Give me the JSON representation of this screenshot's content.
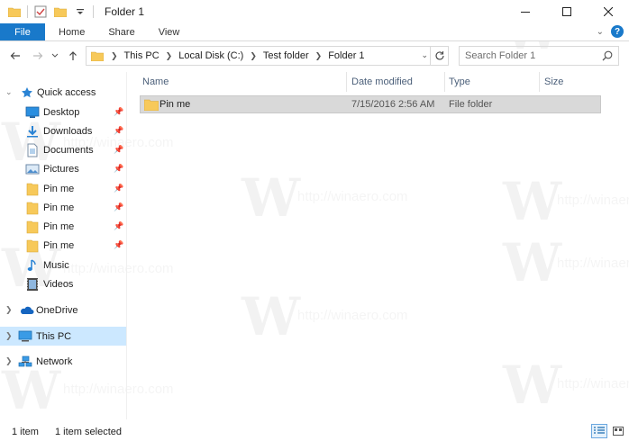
{
  "window": {
    "title": "Folder 1"
  },
  "ribbon": {
    "tabs": [
      {
        "label": "File"
      },
      {
        "label": "Home"
      },
      {
        "label": "Share"
      },
      {
        "label": "View"
      }
    ],
    "help_label": "?"
  },
  "address": {
    "crumbs": [
      "This PC",
      "Local Disk (C:)",
      "Test folder",
      "Folder 1"
    ]
  },
  "search": {
    "placeholder": "Search Folder 1"
  },
  "nav": {
    "quick_access": "Quick access",
    "items": [
      {
        "label": "Desktop",
        "icon": "desktop-icon",
        "pinned": true
      },
      {
        "label": "Downloads",
        "icon": "downloads-icon",
        "pinned": true
      },
      {
        "label": "Documents",
        "icon": "documents-icon",
        "pinned": true
      },
      {
        "label": "Pictures",
        "icon": "pictures-icon",
        "pinned": true
      },
      {
        "label": "Pin me",
        "icon": "folder-icon",
        "pinned": true
      },
      {
        "label": "Pin me",
        "icon": "folder-icon",
        "pinned": true
      },
      {
        "label": "Pin me",
        "icon": "folder-icon",
        "pinned": true
      },
      {
        "label": "Pin me",
        "icon": "folder-icon",
        "pinned": true
      },
      {
        "label": "Music",
        "icon": "music-icon",
        "pinned": false
      },
      {
        "label": "Videos",
        "icon": "videos-icon",
        "pinned": false
      }
    ],
    "onedrive": "OneDrive",
    "this_pc": "This PC",
    "network": "Network"
  },
  "columns": {
    "name": "Name",
    "date_modified": "Date modified",
    "type": "Type",
    "size": "Size"
  },
  "files": [
    {
      "name": "Pin me",
      "date_modified": "7/15/2016 2:56 AM",
      "type": "File folder",
      "size": ""
    }
  ],
  "status": {
    "item_count": "1 item",
    "selected": "1 item selected"
  },
  "watermark": {
    "text": "http://winaero.com",
    "letter": "W"
  },
  "colors": {
    "accent": "#1979ca",
    "selection": "#cce8ff",
    "row_selected": "#d9d9d9",
    "folder": "#f7c95a"
  }
}
